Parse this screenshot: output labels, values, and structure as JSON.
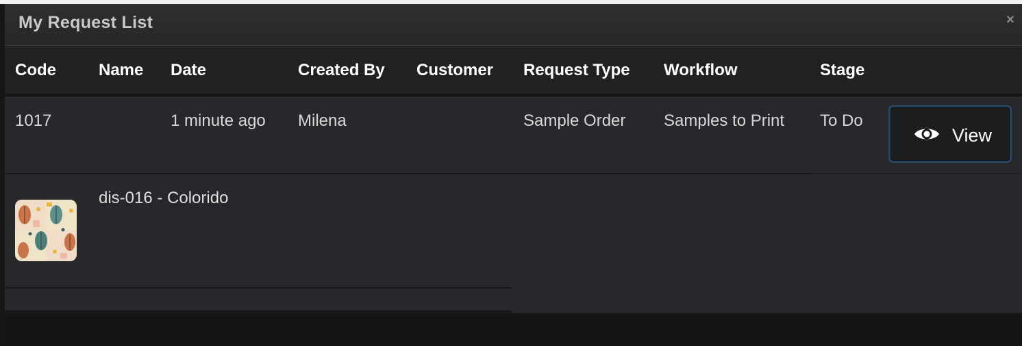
{
  "modal": {
    "title": "My Request List",
    "close_label": "×"
  },
  "table": {
    "headers": [
      "Code",
      "Name",
      "Date",
      "Created By",
      "Customer",
      "Request Type",
      "Workflow",
      "Stage"
    ],
    "rows": [
      {
        "code": "1017",
        "name": "",
        "date": "1 minute ago",
        "created_by": "Milena",
        "customer": "",
        "request_type": "Sample Order",
        "workflow": "Samples to Print",
        "stage": "To Do",
        "action_label": "View",
        "item": {
          "name": "dis-016 - Colorido",
          "thumbnail_icon": "pattern-thumbnail"
        }
      }
    ]
  },
  "colors": {
    "background": "#1f2022",
    "row": "#27282b",
    "button_border": "#2c4563",
    "text": "#ffffff"
  }
}
